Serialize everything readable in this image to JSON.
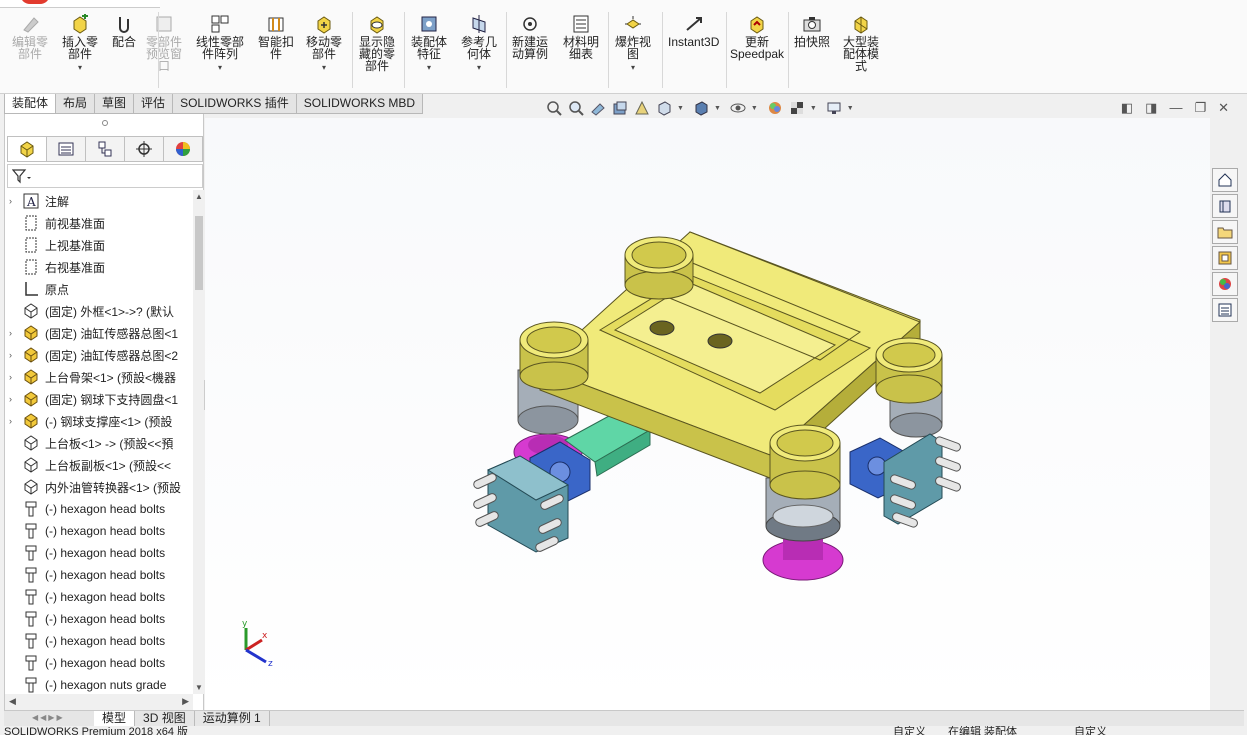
{
  "ribbon": {
    "buttons": [
      {
        "id": "edit-component",
        "label": "编辑零\n部件",
        "disabled": true,
        "dropdown": false
      },
      {
        "id": "insert-components",
        "label": "插入零\n部件",
        "disabled": false,
        "dropdown": true
      },
      {
        "id": "mate",
        "label": "配合",
        "disabled": false,
        "dropdown": false
      },
      {
        "id": "component-preview",
        "label": "零部件\n预览窗\n口",
        "disabled": true,
        "dropdown": false
      },
      {
        "id": "linear-pattern",
        "label": "线性零部\n件阵列",
        "disabled": false,
        "dropdown": true
      },
      {
        "id": "smart-fasteners",
        "label": "智能扣\n件",
        "disabled": false,
        "dropdown": false
      },
      {
        "id": "move-component",
        "label": "移动零\n部件",
        "disabled": false,
        "dropdown": true
      },
      {
        "id": "show-hidden",
        "label": "显示隐\n藏的零\n部件",
        "disabled": false,
        "dropdown": false
      },
      {
        "id": "assembly-features",
        "label": "装配体\n特征",
        "disabled": false,
        "dropdown": true
      },
      {
        "id": "reference-geometry",
        "label": "参考几\n何体",
        "disabled": false,
        "dropdown": true
      },
      {
        "id": "new-motion-study",
        "label": "新建运\n动算例",
        "disabled": false,
        "dropdown": false
      },
      {
        "id": "bom",
        "label": "材料明\n细表",
        "disabled": false,
        "dropdown": false
      },
      {
        "id": "exploded-view",
        "label": "爆炸视\n图",
        "disabled": false,
        "dropdown": true
      },
      {
        "id": "instant3d",
        "label": "Instant3D",
        "disabled": false,
        "dropdown": false
      },
      {
        "id": "speedpak",
        "label": "更新\nSpeedpak",
        "disabled": false,
        "dropdown": false
      },
      {
        "id": "snapshot",
        "label": "拍快照",
        "disabled": false,
        "dropdown": false
      },
      {
        "id": "large-assembly",
        "label": "大型装\n配体模\n式",
        "disabled": false,
        "dropdown": false
      }
    ]
  },
  "tabs": [
    "装配体",
    "布局",
    "草图",
    "评估",
    "SOLIDWORKS 插件",
    "SOLIDWORKS MBD"
  ],
  "tree": {
    "items": [
      {
        "label": "注解",
        "icon": "annotation-icon",
        "expand": true
      },
      {
        "label": "前视基准面",
        "icon": "plane-icon",
        "expand": false
      },
      {
        "label": "上视基准面",
        "icon": "plane-icon",
        "expand": false
      },
      {
        "label": "右视基准面",
        "icon": "plane-icon",
        "expand": false
      },
      {
        "label": "原点",
        "icon": "origin-icon",
        "expand": false
      },
      {
        "label": "(固定) 外框<1>->? (默认",
        "icon": "part-icon",
        "expand": false
      },
      {
        "label": "(固定) 油缸传感器总图<1",
        "icon": "subassembly-icon",
        "expand": true
      },
      {
        "label": "(固定) 油缸传感器总图<2",
        "icon": "subassembly-icon",
        "expand": true
      },
      {
        "label": "上台骨架<1> (预設<機器",
        "icon": "subassembly-icon",
        "expand": true
      },
      {
        "label": "(固定) 钢球下支持圆盘<1",
        "icon": "subassembly-icon",
        "expand": true
      },
      {
        "label": "(-) 钢球支撑座<1> (预設",
        "icon": "subassembly-icon",
        "expand": true
      },
      {
        "label": "上台板<1> -> (预設<<預",
        "icon": "part-icon",
        "expand": false
      },
      {
        "label": "上台板副板<1> (预設<<",
        "icon": "part-icon",
        "expand": false
      },
      {
        "label": "内外油管转换器<1> (预設",
        "icon": "part-icon",
        "expand": false
      },
      {
        "label": "(-) hexagon head bolts",
        "icon": "bolt-icon",
        "expand": false
      },
      {
        "label": "(-) hexagon head bolts",
        "icon": "bolt-icon",
        "expand": false
      },
      {
        "label": "(-) hexagon head bolts",
        "icon": "bolt-icon",
        "expand": false
      },
      {
        "label": "(-) hexagon head bolts",
        "icon": "bolt-icon",
        "expand": false
      },
      {
        "label": "(-) hexagon head bolts",
        "icon": "bolt-icon",
        "expand": false
      },
      {
        "label": "(-) hexagon head bolts",
        "icon": "bolt-icon",
        "expand": false
      },
      {
        "label": "(-) hexagon head bolts",
        "icon": "bolt-icon",
        "expand": false
      },
      {
        "label": "(-) hexagon head bolts",
        "icon": "bolt-icon",
        "expand": false
      },
      {
        "label": "(-) hexagon nuts grade",
        "icon": "bolt-icon",
        "expand": false
      }
    ]
  },
  "bottom_tabs": [
    "模型",
    "3D 视图",
    "运动算例 1"
  ],
  "status": {
    "left": "SOLIDWORKS Premium 2018 x64 版",
    "mid1": "自定义",
    "mid2": "在编辑 装配体",
    "right": "自定义"
  },
  "colors": {
    "frame_yellow": "#f0ea7a",
    "frame_yellow_dark": "#c9c24a",
    "steel": "#9aa3ad",
    "magenta": "#d63ad0",
    "flange_teal": "#5f9aa8",
    "connector_blue": "#3a66c8",
    "cylinder_green": "#5fd6a6"
  },
  "triad": {
    "x": "x",
    "y": "y",
    "z": "z"
  }
}
